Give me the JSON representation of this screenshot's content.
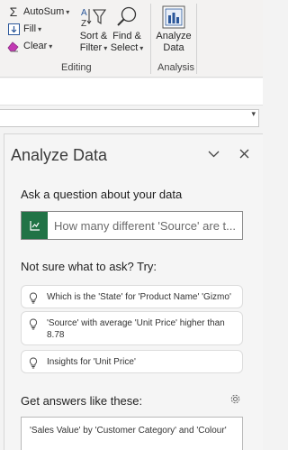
{
  "ribbon": {
    "autosum_label": "AutoSum",
    "fill_label": "Fill",
    "clear_label": "Clear",
    "sort_filter_line1": "Sort &",
    "sort_filter_line2": "Filter",
    "find_select_line1": "Find &",
    "find_select_line2": "Select",
    "analyze_line1": "Analyze",
    "analyze_line2": "Data",
    "group_editing": "Editing",
    "group_analysis": "Analysis"
  },
  "pane": {
    "title": "Analyze Data",
    "ask_heading": "Ask a question about your data",
    "ask_placeholder": "How many different 'Source' are t...",
    "try_heading": "Not sure what to ask? Try:",
    "suggestions": [
      "Which is the 'State' for 'Product Name' 'Gizmo'",
      "'Source' with average 'Unit Price' higher than 8.78",
      "Insights for 'Unit Price'"
    ],
    "answers_heading": "Get answers like these:",
    "answer_card_text": "'Sales Value' by 'Customer Category' and 'Colour'"
  },
  "colors": {
    "accent_green": "#217346",
    "pane_bg": "#f5f5f5"
  },
  "icons": {
    "autosum": "sigma-icon",
    "fill": "fill-down-icon",
    "clear": "eraser-icon",
    "sort_filter": "sort-filter-icon",
    "find_select": "magnifier-icon",
    "analyze_data": "analyze-data-icon",
    "pane_collapse": "chevron-down-icon",
    "pane_close": "close-icon",
    "ask": "chart-line-icon",
    "suggestion": "lightbulb-icon",
    "settings": "gear-icon"
  }
}
